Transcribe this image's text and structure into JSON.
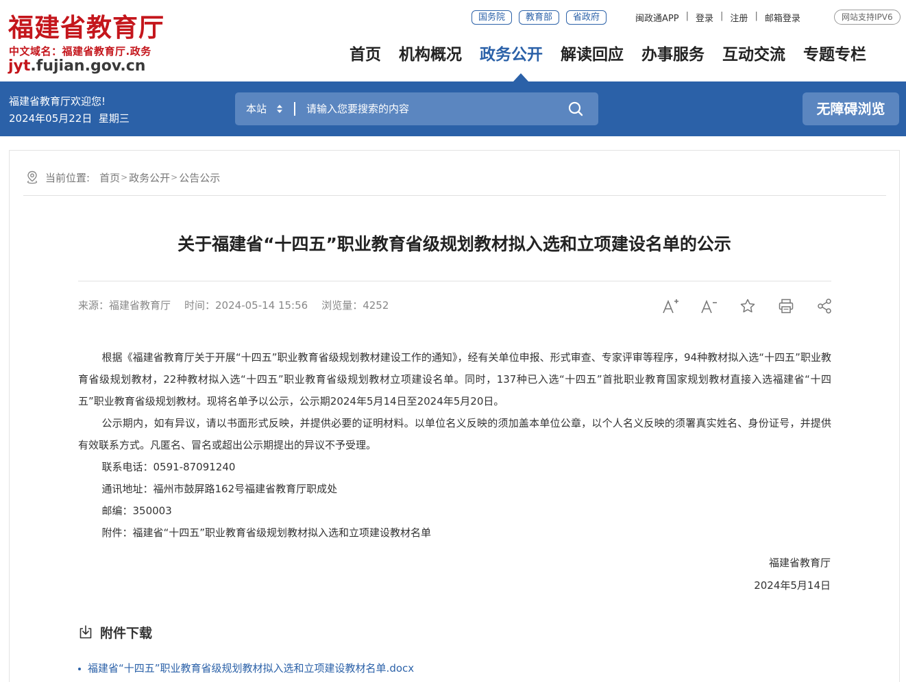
{
  "header": {
    "site_title": "福建省教育厅",
    "domain_label": "中文域名：福建省教育厅.政务",
    "url_accent": "jyt",
    "url_rest": ".fujian.gov.cn",
    "gov_links": [
      "国务院",
      "教育部",
      "省政府"
    ],
    "top_links": [
      "闽政通APP",
      "登录",
      "注册",
      "邮箱登录"
    ],
    "ipv6": "网站支持IPV6",
    "nav": [
      "首页",
      "机构概况",
      "政务公开",
      "解读回应",
      "办事服务",
      "互动交流",
      "专题专栏"
    ],
    "active_nav": "政务公开"
  },
  "bluebar": {
    "welcome": "福建省教育厅欢迎您!",
    "date": "2024年05月22日  星期三",
    "search_scope": "本站",
    "search_placeholder": "请输入您要搜索的内容",
    "accessibility": "无障碍浏览"
  },
  "breadcrumb": {
    "label": "当前位置:",
    "items": [
      "首页",
      "政务公开",
      "公告公示"
    ]
  },
  "article": {
    "title": "关于福建省“十四五”职业教育省级规划教材拟入选和立项建设名单的公示",
    "source": "来源：福建省教育厅",
    "time": "时间：2024-05-14 15:56",
    "views": "浏览量：4252",
    "paragraphs": [
      "根据《福建省教育厅关于开展“十四五”职业教育省级规划教材建设工作的通知》，经有关单位申报、形式审查、专家评审等程序，94种教材拟入选“十四五”职业教育省级规划教材，22种教材拟入选“十四五”职业教育省级规划教材立项建设名单。同时，137种已入选“十四五”首批职业教育国家规划教材直接入选福建省“十四五”职业教育省级规划教材。现将名单予以公示，公示期2024年5月14日至2024年5月20日。",
      "公示期内，如有异议，请以书面形式反映，并提供必要的证明材料。以单位名义反映的须加盖本单位公章，以个人名义反映的须署真实姓名、身份证号，并提供有效联系方式。凡匿名、冒名或超出公示期提出的异议不予受理。",
      "联系电话：0591-87091240",
      "通讯地址：福州市鼓屏路162号福建省教育厅职成处",
      "邮编：350003",
      "附件：福建省“十四五”职业教育省级规划教材拟入选和立项建设教材名单"
    ],
    "signature_org": "福建省教育厅",
    "signature_date": "2024年5月14日"
  },
  "attachments": {
    "heading": "附件下载",
    "files": [
      "福建省“十四五”职业教育省级规划教材拟入选和立项建设教材名单.docx"
    ]
  },
  "colors": {
    "brand_red": "#c4161c",
    "brand_blue": "#2b61a8"
  },
  "icons": [
    "location-icon",
    "font-increase-icon",
    "font-decrease-icon",
    "star-icon",
    "print-icon",
    "share-icon",
    "search-icon",
    "download-icon"
  ]
}
